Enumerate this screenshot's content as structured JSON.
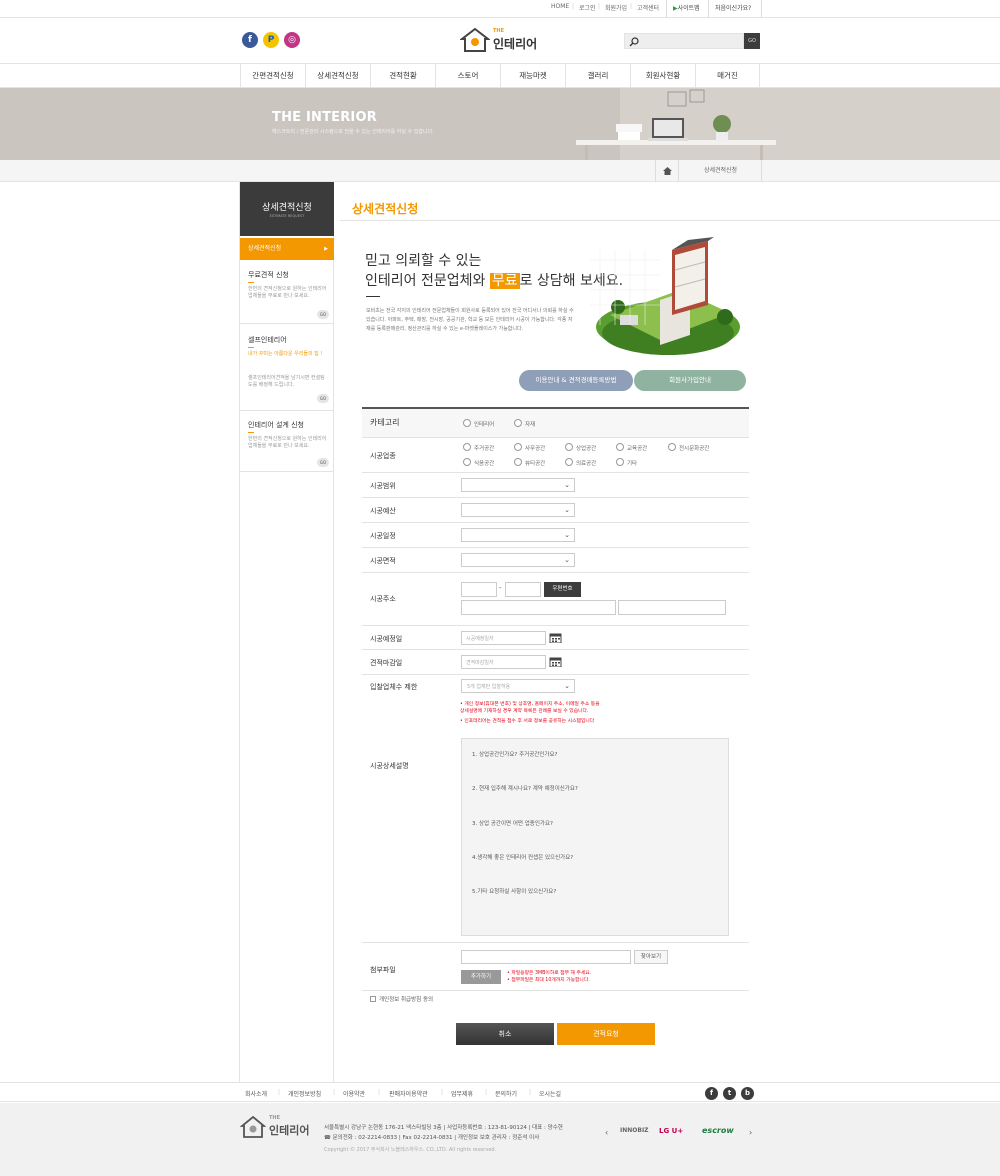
{
  "util": {
    "home": "HOME",
    "login": "로그인",
    "join": "회원가입",
    "cs": "고객센터",
    "sitemap": "사이트맵",
    "help": "처음이신가요?"
  },
  "header": {
    "logo_the": "THE",
    "logo_name": "인테리어",
    "search_go": "GO",
    "sns": [
      "f",
      "P",
      "◎"
    ]
  },
  "gnb": [
    "간편견적신청",
    "상세견적신청",
    "견적현황",
    "스토어",
    "재능마켓",
    "갤러리",
    "회원사현황",
    "매거진"
  ],
  "banner": {
    "title": "THE INTERIOR",
    "subtitle": "헤스크트리 / 전문관리 시스템으로 믿을 수 있는 인테리어를 하실 수 있습니다."
  },
  "location": {
    "current": "상세견적신청"
  },
  "side": {
    "title": "상세견적신청",
    "subtitle": "ESTIMATE REQUEST",
    "active": "상세견적신청",
    "blocks": [
      {
        "title": "무료견적 신청",
        "desc": "한번의 견적신청으로 원하는 인테리어 업체들을 무료로 만나 보세요.",
        "go": "GO"
      },
      {
        "title": "셀프인테리어",
        "accent": "내가 꾸미는 아름다운 우리들의 집 !",
        "desc": "셀프인테리어견적을 남기시면 컨설팅도를 배정해 드립니다.",
        "go": "GO"
      },
      {
        "title": "인테리어 설계 신청",
        "desc": "한번의 견적신청으로 원하는 인테리어 업체들을 무료로 만나 보세요.",
        "go": "GO"
      }
    ]
  },
  "content": {
    "page_title": "상세견적신청",
    "intro_line1": "믿고 의뢰할 수 있는",
    "intro_line2_a": "인테리어 전문업체와 ",
    "intro_line2_hl": "무료",
    "intro_line2_b": "로 상담해 보세요.",
    "intro_desc": "모비초는 전국 각지의 인테리어 전문업체들이 회원사로 등록되어 있어 전국 어디서나 의뢰를 하실 수 있습니다. 아파트, 주택, 매장, 전시장, 공공기관, 학교 등 모든 인테리어 시공이 가능합니다. 각종 자재를 등록판매관리, 정산관리를 하실 수 있는 e-마켓플레이스가 가능합니다.",
    "btn_guide": "이용안내 & 견적경매등록방법",
    "btn_member": "회원사가입안내"
  },
  "form": {
    "category_label": "카테고리",
    "category_options": [
      "인테리어",
      "자재"
    ],
    "type_label": "시공업종",
    "type_options": [
      "주거공간",
      "사무공간",
      "상업공간",
      "교육공간",
      "전시문화공간",
      "식음공간",
      "뷰티공간",
      "의료공간",
      "기타"
    ],
    "scope_label": "시공범위",
    "budget_label": "시공예산",
    "schedule_label": "시공일정",
    "area_label": "시공면적",
    "address_label": "시공주소",
    "zip_dash": "-",
    "zip_button": "우편번호",
    "planned_label": "시공예정일",
    "planned_placeholder": "시공예정일자",
    "deadline_label": "견적마감일",
    "deadline_placeholder": "견적마감일자",
    "limit_label": "입찰업체수 제한",
    "limit_value": "5개 업체만 입찰허용",
    "notes": [
      "• 개인 정보(휴대폰 번호) 및 상호명, 홈페이지 주소, 이메일 주소 등을",
      "  상세설명에 기재하실 경우 계약 목록은 관례를 보실 수 있습니다.",
      "• 인포테리어는 견적을 접수 후 서로 정보를 공유하는 시스템입니다"
    ],
    "detail_label": "시공상세설명",
    "questions": [
      "1. 상업공간인가요? 주거공간인가요?",
      "2. 현재 입주해 계시나요? 계약 예정이신가요?",
      "3. 상업 공간이면 어떤 업종인가요?",
      "4.생각해 좋은 인테리어 컨셉은 있으신가요?",
      "5.기타 요청하실 사항이 있으신가요?"
    ],
    "file_label": "첨부파일",
    "find_button": "찾아보기",
    "add_button": "추가하기",
    "file_notes": [
      "• 파일용량은 3MB이하로 첨부 해 주세요.",
      "• 첨부파일은 최대 10개까지 가능합니다."
    ],
    "agree_label": "개인정보 취급방침 동의",
    "cancel": "취소",
    "submit": "견적요청"
  },
  "footer": {
    "nav": [
      "회사소개",
      "개인정보방침",
      "이용약관",
      "판매자이용약관",
      "업무제휴",
      "문의하기",
      "오시는길"
    ],
    "social": [
      "f",
      "t",
      "b"
    ],
    "logo_the": "THE",
    "logo_name": "인테리어",
    "addr1": "서울특별시 강남구 논현동 176-21 넥스타빌딩 3층  |  사업자등록번호 : 123-81-90124  |  대표 : 양수현",
    "addr2": "☎ 문의전화 : 02-2214-0833  |  Fax 02-2214-0831  |  개인정보 보호 관리자 : 정준석 이사",
    "copyright": "Copyright © 2017 주식회사 노블레스하우스. CO.,LTD.  All rights reserved.",
    "partners": [
      "INNOBIZ",
      "LG U+",
      "escrow"
    ]
  },
  "colors": {
    "accent": "#f39800",
    "dark": "#3c3c3c",
    "pill_blue": "#8e9fb7",
    "pill_green": "#8fb3a0"
  }
}
